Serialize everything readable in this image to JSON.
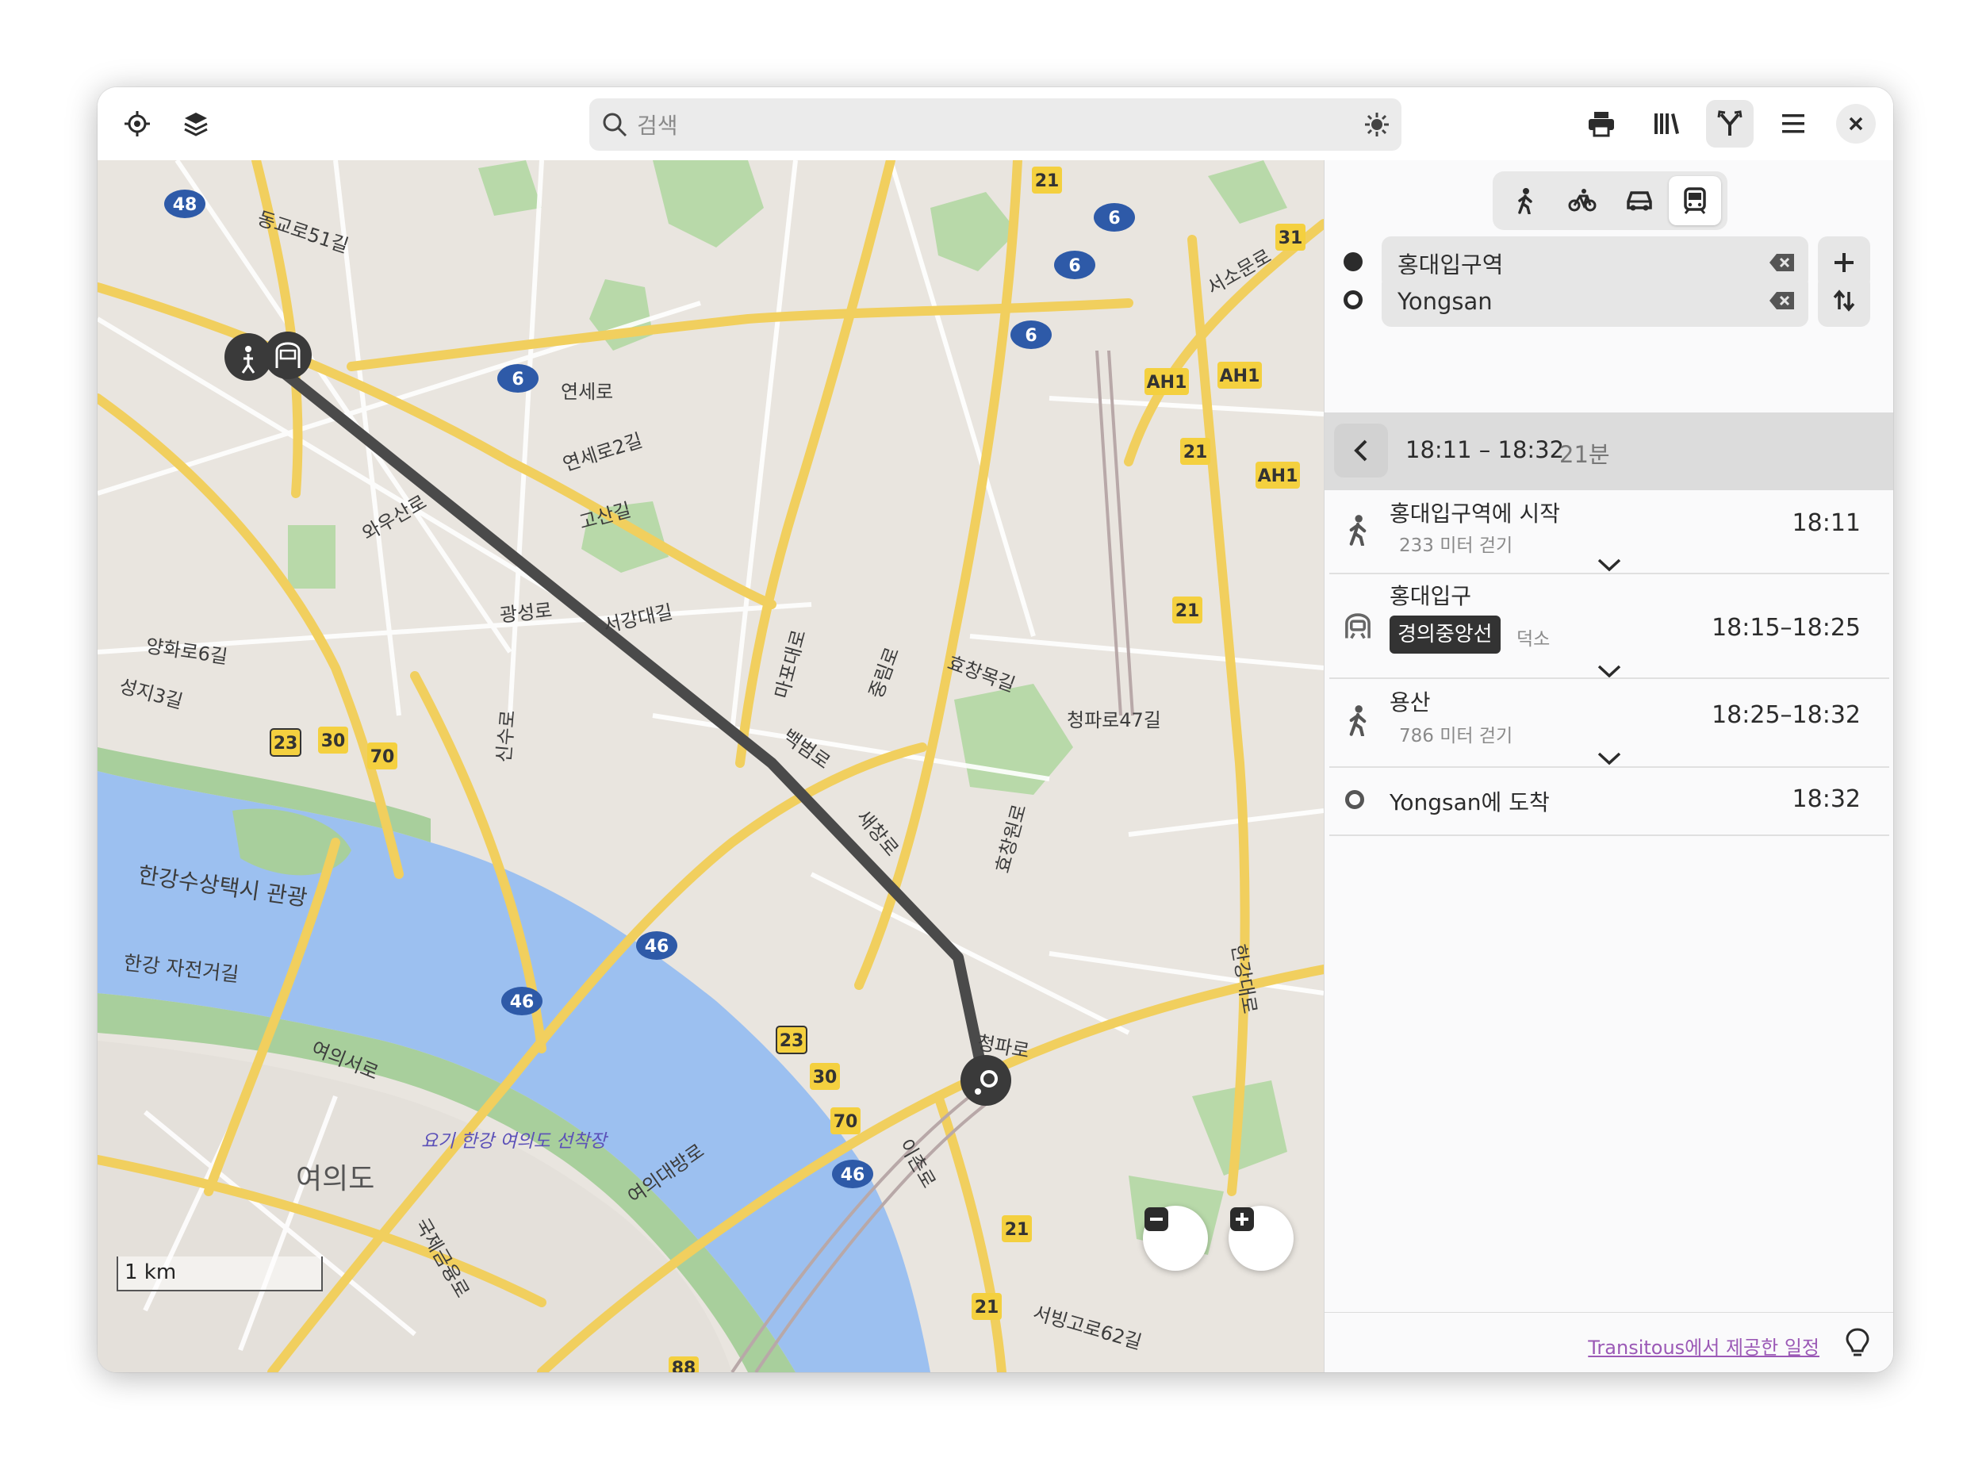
{
  "header": {
    "search_placeholder": "검색"
  },
  "map": {
    "scale_label": "1 km",
    "labels": {
      "yeonseoro": "연세로",
      "yeonseoro2": "연세로2길",
      "gosangil": "고산길",
      "gwangseongro": "광성로",
      "seogangdaegil": "서강대길",
      "waususanro": "와우산로",
      "baekbeomro": "백범로",
      "saechangro": "새창로",
      "cheongparo": "청파로",
      "cheongparo47": "청파로47길",
      "hyochangwonro": "효창원로",
      "hangang_taxi": "한강수상택시 관광",
      "hangang_bike": "한강 자전거길",
      "yeouido": "여의도",
      "yeouiseoro": "여의서로",
      "yeouidaebangro": "여의대방로",
      "ferry": "요기 한강 여의도 선착장",
      "dongguro51": "동교로51길",
      "seosomunro": "서소문로",
      "seobinggoro62": "서빙고로62길",
      "mapodaero": "마포대로",
      "hangangdaero": "한강대로",
      "yanghwaro6": "양화로6길",
      "seongji3": "성지3길",
      "singsuro": "신수로",
      "jungrimro": "중림로",
      "hyoriro": "효창목길",
      "ichonro": "이촌로",
      "gukjegeumyungro": "국제금융로"
    },
    "route_shields": [
      "48",
      "6",
      "6",
      "6",
      "6",
      "46",
      "46",
      "46",
      "21",
      "21",
      "21",
      "21",
      "31",
      "AH1",
      "AH1",
      "AH1",
      "23",
      "23",
      "30",
      "30",
      "70",
      "70",
      "88"
    ]
  },
  "sidebar": {
    "origin": "홍대입구역",
    "destination": "Yongsan",
    "summary": {
      "times": "18:11 – 18:32",
      "duration": "21분"
    },
    "steps": [
      {
        "title": "홍대입구역에 시작",
        "sub": "233 미터 걷기",
        "time": "18:11"
      },
      {
        "title": "홍대입구",
        "line": "경의중앙선",
        "direction": "덕소",
        "time": "18:15–18:25"
      },
      {
        "title": "용산",
        "sub": "786 미터 걷기",
        "time": "18:25–18:32"
      },
      {
        "title": "Yongsan에 도착",
        "time": "18:32"
      }
    ],
    "attribution": "Transitous에서 제공한 일정"
  },
  "colors": {
    "route": "#4a4a4a",
    "water": "#9cc0f0",
    "park": "#b7d8a8",
    "road_major": "#f3d46a",
    "link": "#9b59b6"
  }
}
